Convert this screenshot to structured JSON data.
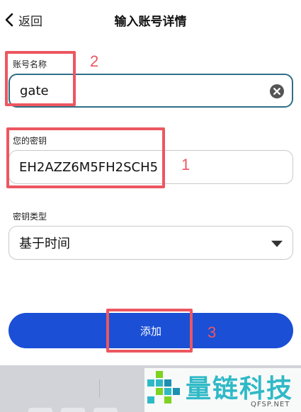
{
  "header": {
    "back_label": "返回",
    "title": "输入账号详情"
  },
  "account_name": {
    "label": "账号名称",
    "value": "gate"
  },
  "secret_key": {
    "label": "您的密钥",
    "value": "EH2AZZ6M5FH2SCH5"
  },
  "key_type": {
    "label": "密钥类型",
    "selected": "基于时间"
  },
  "add_button": {
    "label": "添加"
  },
  "annotations": {
    "one": "1",
    "two": "2",
    "three": "3"
  },
  "watermark": {
    "text": "量链科技",
    "sub": "QFSP.NET"
  },
  "colors": {
    "accent": "#1a4fd6",
    "active_border": "#2e6f86",
    "annotation": "#ec5760",
    "watermark": "#2fb9c7"
  }
}
